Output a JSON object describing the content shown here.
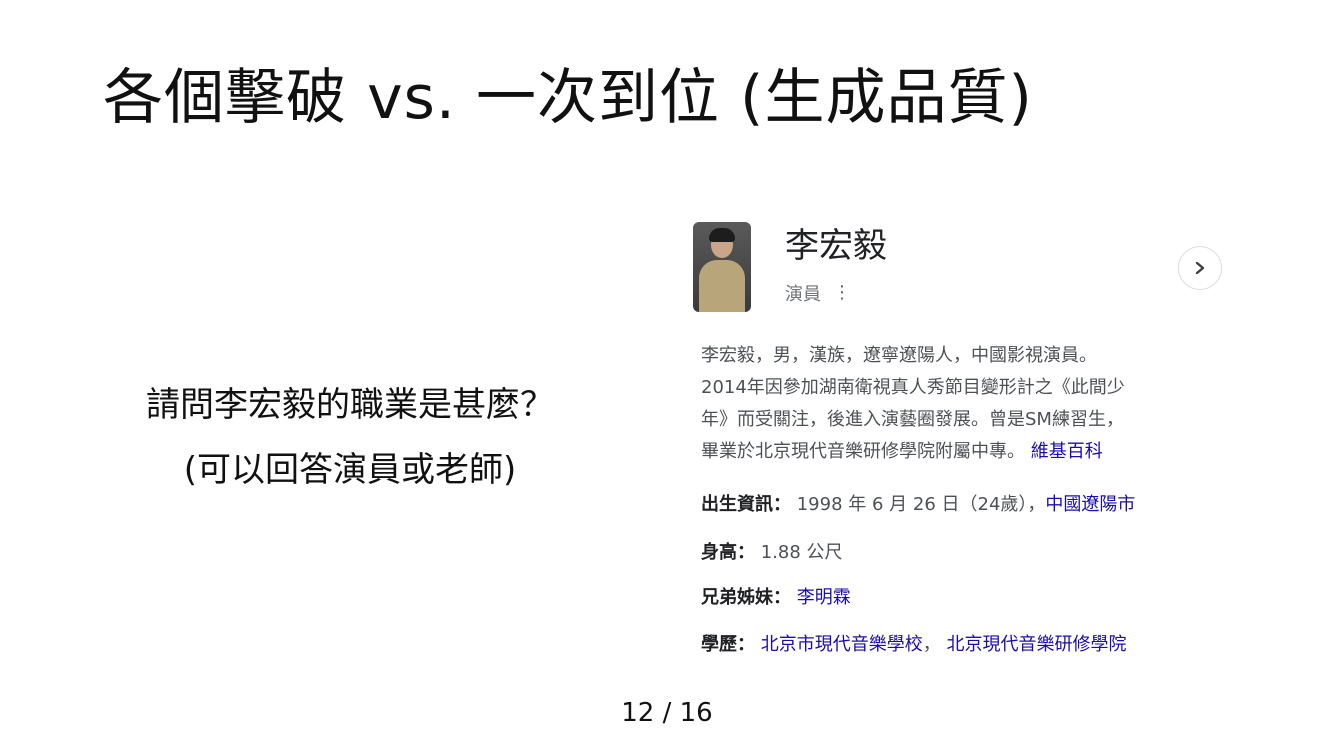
{
  "slide": {
    "title": "各個擊破 vs. 一次到位 (生成品質)",
    "question_line1": "請問李宏毅的職業是甚麼？",
    "question_line2": "(可以回答演員或老師)",
    "page_number": "12 / 16"
  },
  "knowledge_panel": {
    "name": "李宏毅",
    "subtitle": "演員",
    "more_icon": "kebab-icon",
    "chevron_icon": "chevron-right-icon",
    "description_line1": "李宏毅，男，漢族，遼寧遼陽人，中國影視演員。",
    "description_line2": "2014年因參加湖南衛視真人秀節目變形計之《此間少",
    "description_line3": "年》而受關注，後進入演藝圈發展。曾是SM練習生，",
    "description_line4": "畢業於北京現代音樂研修學院附屬中專。",
    "wikipedia_link": "維基百科",
    "birth_label": "出生資訊：",
    "birth_value": "1998 年 6 月 26 日（24歲），",
    "birth_place_link": "中國遼陽市",
    "height_label": "身高：",
    "height_value": "1.88 公尺",
    "siblings_label": "兄弟姊妹：",
    "siblings_link": "李明霖",
    "education_label": "學歷：",
    "education_link1": "北京市現代音樂學校",
    "education_separator": "，",
    "education_link2": "北京現代音樂研修學院",
    "link_color": "#1a0dab"
  }
}
